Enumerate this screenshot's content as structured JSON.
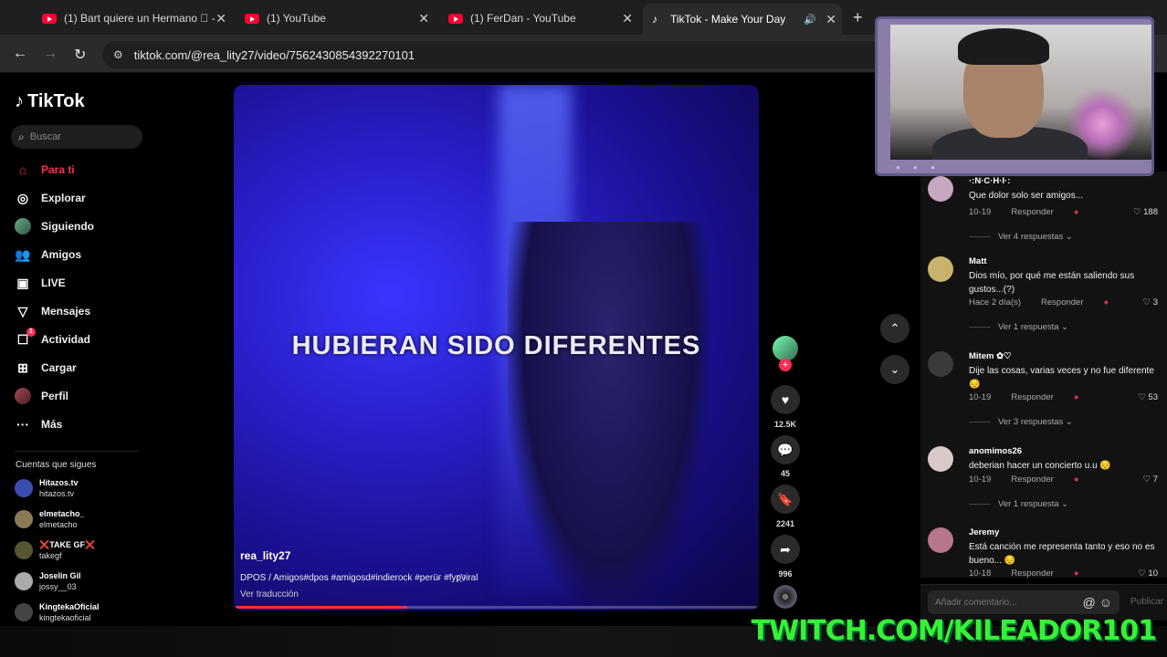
{
  "tabs": [
    {
      "label": "(1) Bart quiere un Hermano 🏻 -",
      "favicon": "youtube-icon"
    },
    {
      "label": "(1) YouTube",
      "favicon": "youtube-icon"
    },
    {
      "label": "(1) FerDan - YouTube",
      "favicon": "youtube-icon"
    },
    {
      "label": "TikTok - Make Your Day",
      "favicon": "tiktok-icon",
      "active": true
    }
  ],
  "address": {
    "url": "tiktok.com/@rea_lity27/video/7562430854392270101"
  },
  "sidebar": {
    "logo": "TikTok",
    "search_placeholder": "Buscar",
    "items": [
      {
        "label": "Para ti",
        "icon": "home-icon",
        "active": true
      },
      {
        "label": "Explorar",
        "icon": "compass-icon"
      },
      {
        "label": "Siguiendo",
        "icon": "following-avatar-icon"
      },
      {
        "label": "Amigos",
        "icon": "friends-icon"
      },
      {
        "label": "LIVE",
        "icon": "live-icon"
      },
      {
        "label": "Mensajes",
        "icon": "message-icon"
      },
      {
        "label": "Actividad",
        "icon": "activity-icon",
        "badge": "1"
      },
      {
        "label": "Cargar",
        "icon": "upload-icon"
      },
      {
        "label": "Perfil",
        "icon": "profile-avatar-icon"
      },
      {
        "label": "Más",
        "icon": "more-icon"
      }
    ],
    "following_header": "Cuentas que sigues",
    "following": [
      {
        "name": "Hitazos.tv",
        "handle": "hitazos.tv"
      },
      {
        "name": "elmetacho_",
        "handle": "elmetacho"
      },
      {
        "name": "❌TAKE GF❌",
        "handle": "takegf"
      },
      {
        "name": "Joselin Gil",
        "handle": "jossy__03"
      },
      {
        "name": "KingtekaOficial",
        "handle": "kingtekaoficial"
      }
    ]
  },
  "video": {
    "caption_overlay": "HUBIERAN SIDO DIFERENTES",
    "username": "rea_lity27",
    "description": "DPOS / Amigos#dpos #amigosd#indierock #perüғ #fyp҈viral",
    "translate": "Ver traducción",
    "progress": 0.33
  },
  "actions": {
    "likes": "12.5K",
    "comments": "45",
    "saves": "2241",
    "shares": "996"
  },
  "comments": [
    {
      "name": "·:N·C·H·I·:",
      "text": "Que dolor solo ser amigos...",
      "date": "10-19",
      "reply": "Responder",
      "likes": "188",
      "more": "Ver 4 respuestas"
    },
    {
      "name": "Matt",
      "text": "Dios mío, por qué me están saliendo sus gustos...(?)",
      "date": "Hace 2 día(s)",
      "reply": "Responder",
      "likes": "3",
      "more": "Ver 1 respuesta"
    },
    {
      "name": "Mitem ✿♡",
      "text": "Dije las cosas, varias veces y no fue diferente 😔",
      "date": "10-19",
      "reply": "Responder",
      "likes": "53",
      "more": "Ver 3 respuestas"
    },
    {
      "name": "anomimos26",
      "text": "deberian hacer un concierto u.u 😔",
      "date": "10-19",
      "reply": "Responder",
      "likes": "7",
      "more": "Ver 1 respuesta"
    },
    {
      "name": "Jeremy",
      "text": "Está canción me representa tanto y eso no es bueno... 😔",
      "date": "10-18",
      "reply": "Responder",
      "likes": "10"
    }
  ],
  "comment_box": {
    "placeholder": "Añadir comentario...",
    "publish": "Publicar"
  },
  "overlay": {
    "twitch": "TWITCH.COM/KILEADOR101"
  },
  "colors": {
    "accent": "#fe2c55",
    "twitch_green": "#35f235"
  }
}
